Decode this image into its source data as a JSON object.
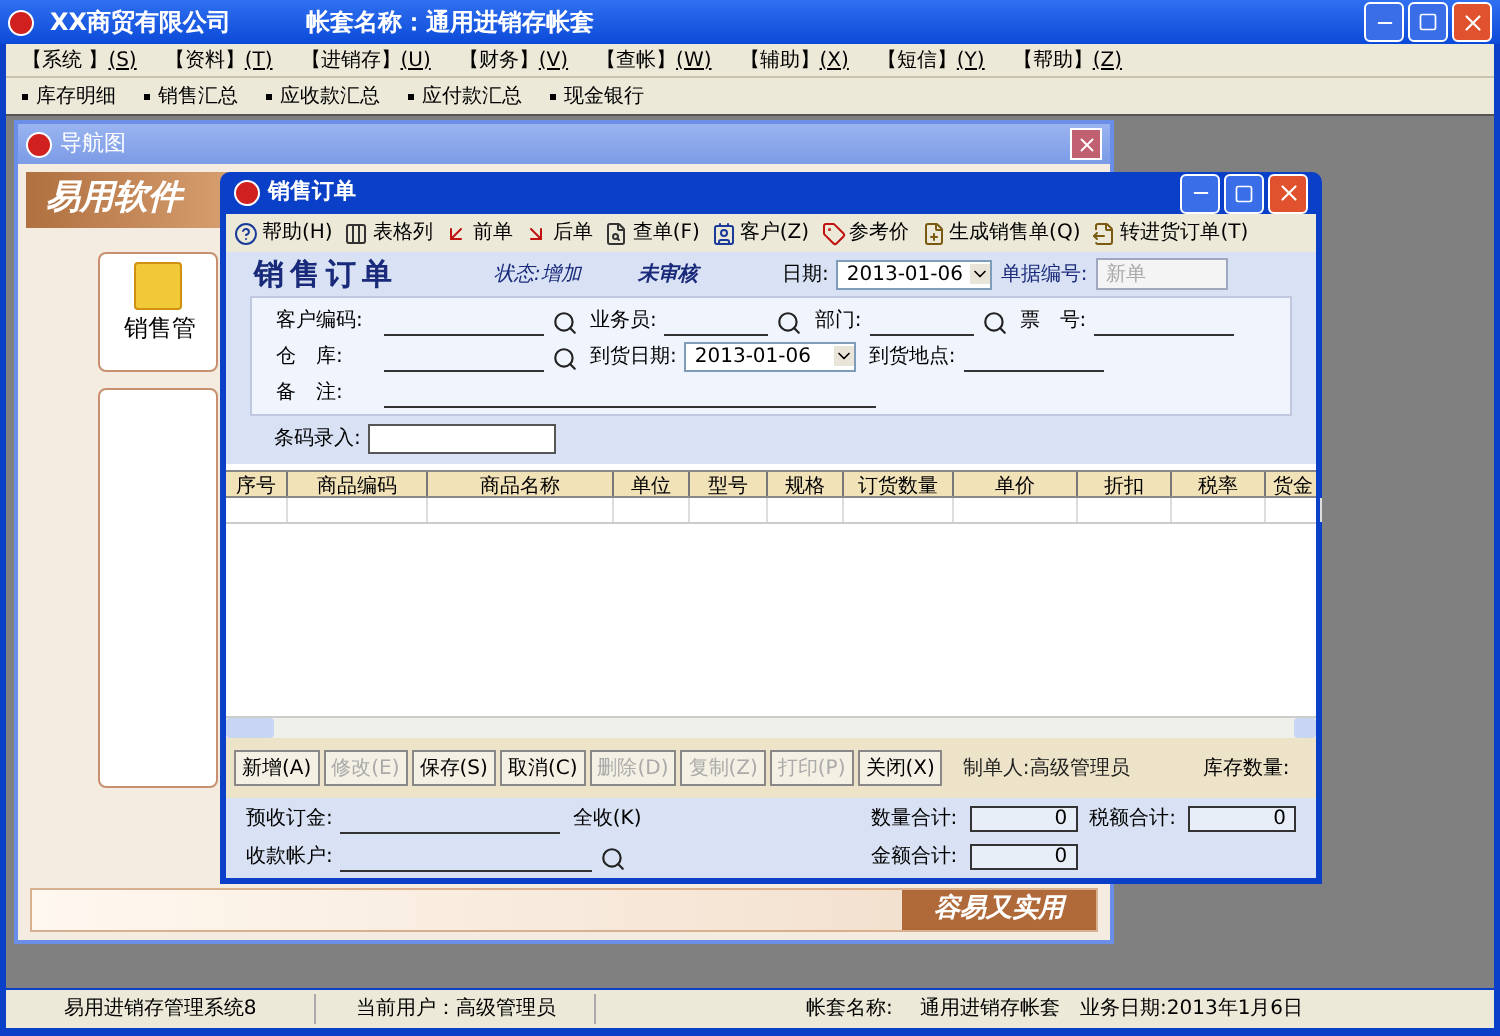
{
  "app_window": {
    "title": "XX商贸有限公司",
    "account_title": "帐套名称：通用进销存帐套"
  },
  "menu": [
    {
      "label": "【系统 】",
      "shortcut": "(S)"
    },
    {
      "label": "【资料】",
      "shortcut": "(T)"
    },
    {
      "label": "【进销存】",
      "shortcut": "(U)"
    },
    {
      "label": "【财务】",
      "shortcut": "(V)"
    },
    {
      "label": "【查帐】",
      "shortcut": "(W)"
    },
    {
      "label": "【辅助】",
      "shortcut": "(X)"
    },
    {
      "label": "【短信】",
      "shortcut": "(Y)"
    },
    {
      "label": "【帮助】",
      "shortcut": "(Z)"
    }
  ],
  "quick_links": [
    "库存明细",
    "销售汇总",
    "应收款汇总",
    "应付款汇总",
    "现金银行"
  ],
  "nav_window": {
    "title": "导航图",
    "logo": "易用软件",
    "module": "销售管",
    "slogan": "容易又实用"
  },
  "order_window": {
    "title": "销售订单",
    "toolbar": [
      {
        "label": "帮助",
        "shortcut": "(H)",
        "kind": "help"
      },
      {
        "label": "表格列",
        "kind": "columns"
      },
      {
        "label": "前单",
        "kind": "prev"
      },
      {
        "label": "后单",
        "kind": "next"
      },
      {
        "label": "查单",
        "shortcut": "(F)",
        "kind": "find"
      },
      {
        "label": "客户",
        "shortcut": "(Z)",
        "kind": "customer"
      },
      {
        "label": "参考价",
        "kind": "price"
      },
      {
        "label": "生成销售单",
        "shortcut": "(Q)",
        "kind": "generate"
      },
      {
        "label": "转进货订单",
        "shortcut": "(T)",
        "kind": "convert"
      }
    ],
    "heading": "销售订单",
    "status": "状态:增加",
    "audit": "未审核",
    "date_label": "日期:",
    "date": "2013-01-06",
    "number_label": "单据编号:",
    "number_placeholder": "新单",
    "field_rows": [
      [
        {
          "label": "客户编码:",
          "kind": "lookup"
        },
        {
          "label": "业务员:",
          "kind": "lookup"
        },
        {
          "label": "部门:",
          "kind": "lookup"
        },
        {
          "label": "票　号:",
          "kind": "line"
        }
      ],
      [
        {
          "label": "仓　库:",
          "kind": "lookup"
        },
        {
          "label": "到货日期:",
          "kind": "date",
          "value": "2013-01-06"
        },
        {
          "label": "到货地点:",
          "kind": "line"
        }
      ],
      [
        {
          "label": "备　注:",
          "kind": "wide"
        }
      ]
    ],
    "barcode_label": "条码录入:",
    "columns": [
      "序号",
      "商品编码",
      "商品名称",
      "单位",
      "型号",
      "规格",
      "订货数量",
      "单价",
      "折扣",
      "税率",
      "货金"
    ],
    "buttons": [
      {
        "label": "新增",
        "shortcut": "(A)",
        "disabled": false
      },
      {
        "label": "修改",
        "shortcut": "(E)",
        "disabled": true
      },
      {
        "label": "保存",
        "shortcut": "(S)",
        "disabled": false
      },
      {
        "label": "取消",
        "shortcut": "(C)",
        "disabled": false
      },
      {
        "label": "删除",
        "shortcut": "(D)",
        "disabled": true
      },
      {
        "label": "复制",
        "shortcut": "(Z)",
        "disabled": true
      },
      {
        "label": "打印",
        "shortcut": "(P)",
        "disabled": true
      },
      {
        "label": "关闭",
        "shortcut": "(X)",
        "disabled": false
      }
    ],
    "preparer": "制单人:高级管理员",
    "stock_label": "库存数量:",
    "deposit_label": "预收订金:",
    "full_label": "全收",
    "full_shortcut": "(K)",
    "account_label": "收款帐户:",
    "totals": [
      {
        "label": "数量合计:",
        "value": "0"
      },
      {
        "label": "税额合计:",
        "value": "0"
      },
      {
        "label": "金额合计:",
        "value": "0"
      }
    ]
  },
  "status_bar": [
    "易用进销存管理系统8",
    "当前用户：高级管理员",
    "帐套名称:",
    "通用进销存帐套",
    "业务日期:2013年1月6日"
  ]
}
